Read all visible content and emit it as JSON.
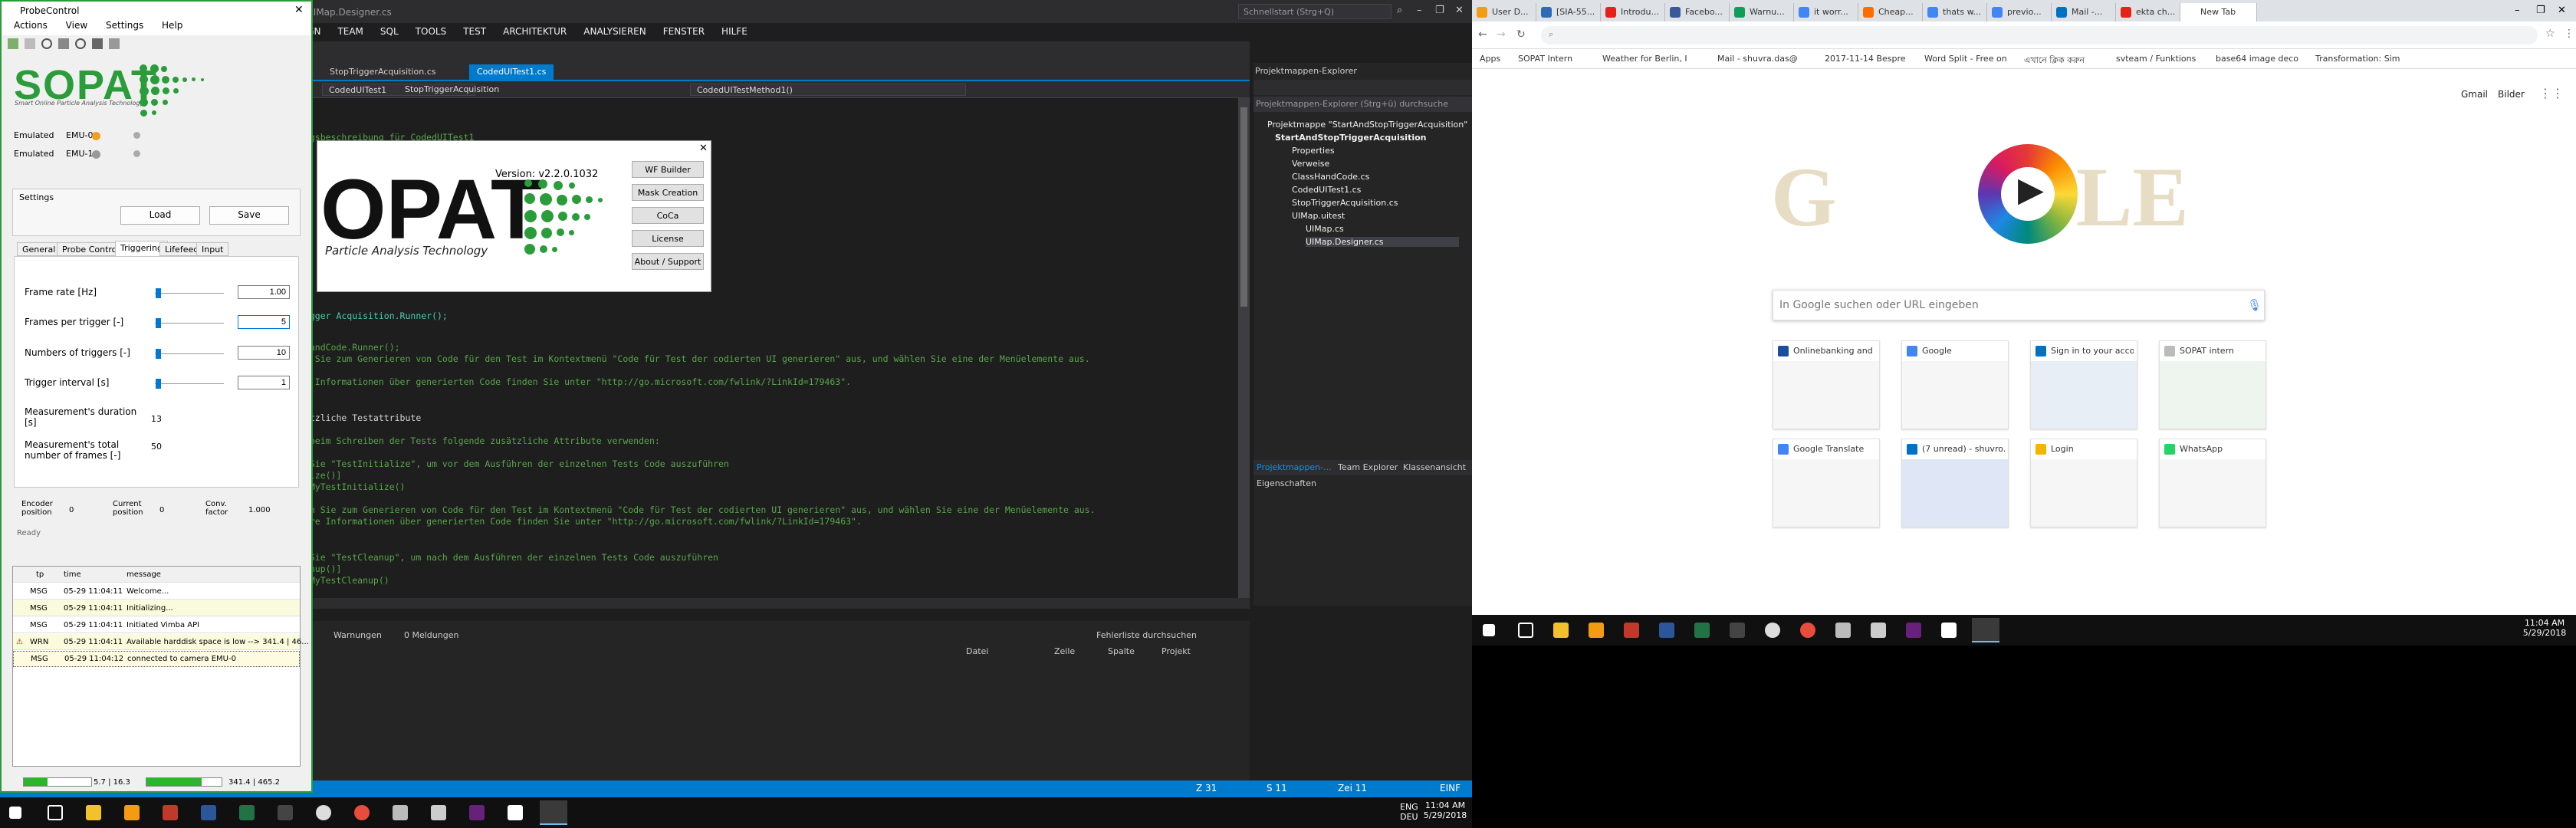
{
  "vs": {
    "title_text": "UIMap.Designer.cs",
    "quick_launch": "Schnellstart (Strg+Q)",
    "menu": [
      "SIGN",
      "TEAM",
      "SQL",
      "TOOLS",
      "TEST",
      "ARCHITEKTUR",
      "ANALYSIEREN",
      "FENSTER",
      "HILFE"
    ],
    "tabs": [
      "StopTriggerAcquisition.cs",
      "CodedUITest1.cs"
    ],
    "nav_left": "CodedUITest1",
    "nav_right": "CodedUITestMethod1()",
    "nav_mid": "StopTriggerAcquisition",
    "code": [
      "ungsbeschreibung für CodedUITest1",
      "rigger Acquisition.Runner();",
      "dHandCode.Runner();",
      "lm Sie zum Generieren von Code für den Test im Kontextmenü \"Code für Test der codierten UI generieren\" aus, und wählen Sie eine der Menüelemente aus.",
      "re Informationen über generierten Code finden Sie unter \"http://go.microsoft.com/fwlink/?LinkId=179463\".",
      "ustzliche Testattribute",
      "n beim Schreiben der Tests folgende zusätzliche Attribute verwenden:",
      "n Sie \"TestInitialize\", um vor dem Ausführen der einzelnen Tests Code auszuführen",
      "alize()]",
      "d MyTestInitialize()",
      "len Sie zum Generieren von Code für den Test im Kontextmenü \"Code für Test der codierten UI generieren\" aus, und wählen Sie eine der Menüelemente aus.",
      "tere Informationen über generierten Code finden Sie unter \"http://go.microsoft.com/fwlink/?LinkId=179463\".",
      "n Sie \"TestCleanup\", um nach dem Ausführen der einzelnen Tests Code auszuführen",
      "eanup()]",
      "d MyTestCleanup()"
    ],
    "solution_explorer": {
      "title": "Projektmappen-Explorer",
      "search": "Projektmappen-Explorer (Strg+ü) durchsuche",
      "items": [
        "Projektmappe \"StartAndStopTriggerAcquisition\"",
        "StartAndStopTriggerAcquisition",
        "Properties",
        "Verweise",
        "ClassHandCode.cs",
        "CodedUITest1.cs",
        "StopTriggerAcquisition.cs",
        "UIMap.uitest",
        "UIMap.cs",
        "UIMap.Designer.cs"
      ],
      "bottom_tabs": [
        "Projektmappen-...",
        "Team Explorer",
        "Klassenansicht"
      ]
    },
    "properties_title": "Eigenschaften",
    "errorlist": {
      "search": "Fehlerliste durchsuchen",
      "messages": "0 Meldungen",
      "warnings": "Warnungen",
      "cols": [
        "Datei",
        "Zeile",
        "Spalte",
        "Projekt"
      ]
    },
    "status": {
      "z": "Z 31",
      "s": "S 11",
      "zei": "Zei 11",
      "mode": "EINF"
    }
  },
  "probe": {
    "title": "ProbeControl",
    "menu": [
      "Actions",
      "View",
      "Settings",
      "Help"
    ],
    "logo": "SOPAT",
    "logo_sub": "Smart Online Particle Analysis Technology",
    "emulators": [
      {
        "label": "Emulated",
        "name": "EMU-0",
        "color": "#f0a020"
      },
      {
        "label": "Emulated",
        "name": "EMU-1",
        "color": "#999999"
      }
    ],
    "settings_label": "Settings",
    "load": "Load",
    "save": "Save",
    "tabs": [
      "General",
      "Probe Control",
      "Triggering",
      "Lifefeed",
      "Input"
    ],
    "params": [
      {
        "label": "Frame rate [Hz]",
        "value": "1.00",
        "fraction": 0.05
      },
      {
        "label": "Frames per trigger [-]",
        "value": "5",
        "fraction": 0.05
      },
      {
        "label": "Numbers of triggers [-]",
        "value": "10",
        "fraction": 0.05
      },
      {
        "label": "Trigger interval [s]",
        "value": "1",
        "fraction": 0.05
      }
    ],
    "duration_label": "Measurement's duration [s]",
    "duration": "13",
    "total_label": "Measurement's total number of frames [-]",
    "total": "50",
    "encoder_label": "Encoder position",
    "encoder": "0",
    "current_label": "Current position",
    "current": "0",
    "conv_label": "Conv. factor",
    "conv": "1.000",
    "ready": "Ready",
    "log_headers": [
      "tp",
      "time",
      "message"
    ],
    "log": [
      {
        "tp": "MSG",
        "time": "05-29 11:04:11",
        "msg": "Welcome..."
      },
      {
        "tp": "MSG",
        "time": "05-29 11:04:11",
        "msg": "Initializing..."
      },
      {
        "tp": "MSG",
        "time": "05-29 11:04:11",
        "msg": "Initiated Vimba API"
      },
      {
        "tp": "WRN",
        "time": "05-29 11:04:11",
        "msg": "Available harddisk space is low --> 341.4 | 46..."
      },
      {
        "tp": "MSG",
        "time": "05-29 11:04:12",
        "msg": "connected to camera EMU-0"
      }
    ],
    "status_left": "5.7 | 16.3",
    "status_right": "341.4 | 465.2"
  },
  "splash": {
    "version": "Version: v2.2.0.1032",
    "logo": "OPAT",
    "sub": "Particle Analysis Technology",
    "buttons": [
      "WF Builder",
      "Mask Creation",
      "CoCa",
      "License",
      "About / Support"
    ]
  },
  "clock1": {
    "time": "11:04 AM",
    "date": "5/29/2018",
    "lang": "ENG",
    "region": "DEU"
  },
  "chrome": {
    "tabs": [
      "User D...",
      "[SIA-55...",
      "Introdu...",
      "Facebo...",
      "Warnu...",
      "it worr...",
      "Cheap...",
      "thats w...",
      "previo...",
      "Mail -...",
      "ekta ch...",
      "New Tab"
    ],
    "bookmarks": [
      "Apps",
      "SOPAT Intern",
      "Weather for Berlin, I",
      "Mail - shuvra.das@",
      "2017-11-14 Bespre",
      "Word Split - Free on",
      "এখানে ক্লিক করুন",
      "svteam / Funktions",
      "base64 image deco",
      "Transformation: Sim"
    ],
    "top_links": [
      "Gmail",
      "Bilder"
    ],
    "search_placeholder": "In Google suchen oder URL eingeben",
    "tiles": [
      "Onlinebanking and ...",
      "Google",
      "Sign in to your acco...",
      "SOPAT intern",
      "Google Translate",
      "(7 unread) - shuvro...",
      "Login",
      "WhatsApp"
    ]
  },
  "clock2": {
    "time": "11:04 AM",
    "date": "5/29/2018"
  }
}
